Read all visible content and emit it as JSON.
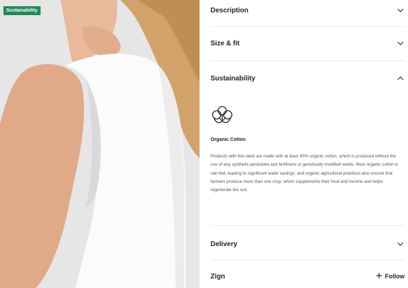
{
  "image": {
    "badge": "Sustainability",
    "colors": {
      "badge_bg": "#1f8a5b",
      "background": "#e6e6e6",
      "top": "#ffffff",
      "skin": "#e8b99a",
      "hair": "#d2a26b"
    }
  },
  "accordion": {
    "description": {
      "label": "Description",
      "icon": "chevron-down-icon"
    },
    "size_fit": {
      "label": "Size & fit",
      "icon": "chevron-down-icon"
    },
    "sustainability": {
      "label": "Sustainability",
      "icon": "chevron-up-icon",
      "material_icon": "cotton-flower-icon",
      "material_title": "Organic Cotton",
      "material_text": "Products with this label are made with at least 90% organic cotton, which is produced without the use of any synthetic pesticides and fertilisers or genetically-modified seeds. Most organic cotton is rain-fed, leading to significant water savings, and organic agricultural practices also ensure that farmers produce more than one crop, which supplements their food and income and helps regenerate the soil."
    },
    "delivery": {
      "label": "Delivery",
      "icon": "chevron-down-icon"
    }
  },
  "brand": {
    "name": "Zign",
    "follow_label": "Follow",
    "follow_icon": "plus-icon"
  }
}
